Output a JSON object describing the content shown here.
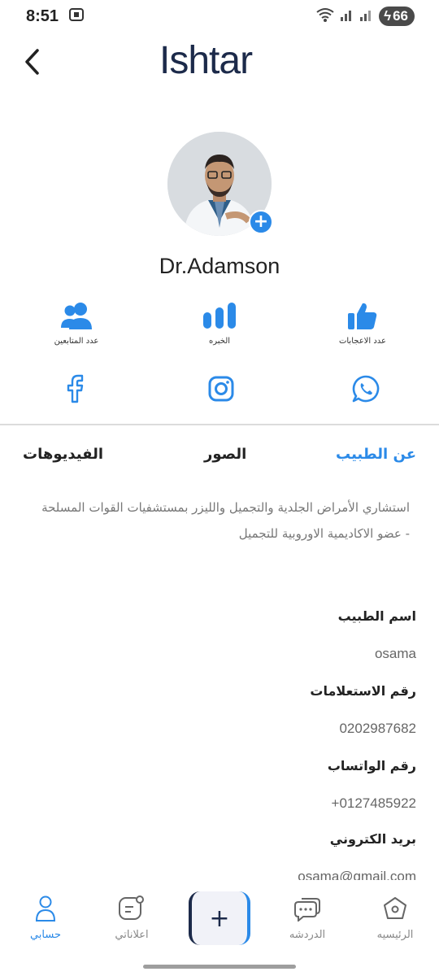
{
  "status_bar": {
    "time": "8:51",
    "battery": "66"
  },
  "header": {
    "logo_text": "Ishtar",
    "back_icon": "chevron-left-icon"
  },
  "profile": {
    "name": "Dr.Adamson"
  },
  "stats": [
    {
      "label": "عدد المتابعين",
      "icon": "followers-icon"
    },
    {
      "label": "الخبره",
      "icon": "experience-bars-icon"
    },
    {
      "label": "عدد الاعجابات",
      "icon": "thumbs-up-icon"
    }
  ],
  "social": [
    {
      "name": "facebook-icon"
    },
    {
      "name": "instagram-icon"
    },
    {
      "name": "whatsapp-icon"
    }
  ],
  "tabs": [
    {
      "label": "الفيديوهات"
    },
    {
      "label": "الصور"
    },
    {
      "label": "عن الطبيب",
      "active": true
    }
  ],
  "about": {
    "line1": "استشاري الأمراض الجلدية والتجميل والليزر بمستشفيات القوات المسلحة",
    "line2": "- عضو الاكاديمية الاوروبية للتجميل"
  },
  "fields": [
    {
      "label": "اسم الطبيب",
      "value": "osama"
    },
    {
      "label": "رقم الاستعلامات",
      "value": "0202987682"
    },
    {
      "label": "رقم الواتساب",
      "value": "+0127485922"
    },
    {
      "label": "بريد الكتروني",
      "value": "osama@gmail.com"
    }
  ],
  "bottom_nav": {
    "items": [
      {
        "label": "حسابي",
        "active": true
      },
      {
        "label": "اعلاناتي"
      },
      {
        "label": "الدردشه"
      },
      {
        "label": "الرئيسيه"
      }
    ],
    "fab_symbol": "+"
  },
  "colors": {
    "accent": "#2b8ae8",
    "brand": "#1c2a4a",
    "muted": "#777777"
  }
}
